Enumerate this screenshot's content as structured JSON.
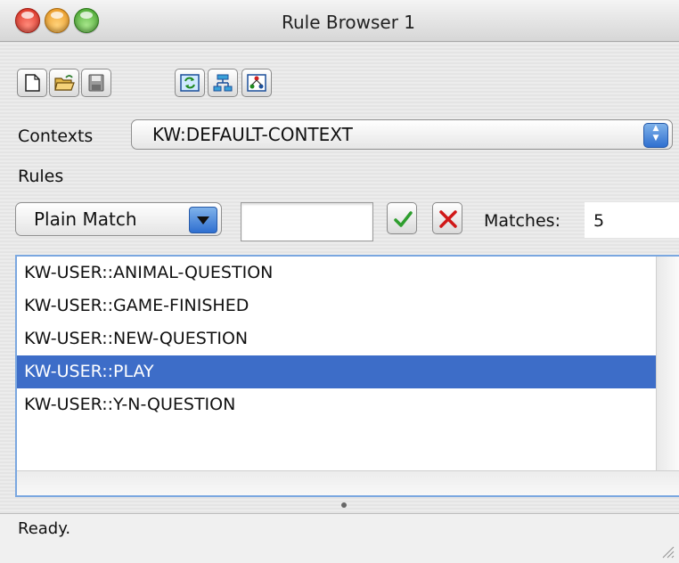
{
  "window": {
    "title": "Rule Browser 1"
  },
  "toolbar": {
    "buttons": [
      {
        "name": "new-document",
        "icon": "new-document-icon"
      },
      {
        "name": "open-folder",
        "icon": "open-folder-icon"
      },
      {
        "name": "save",
        "icon": "save-icon"
      },
      {
        "name": "refresh",
        "icon": "refresh-icon"
      },
      {
        "name": "tree-view",
        "icon": "tree-view-icon"
      },
      {
        "name": "graph-view",
        "icon": "graph-view-icon"
      }
    ]
  },
  "contexts": {
    "label": "Contexts",
    "selected": "KW:DEFAULT-CONTEXT"
  },
  "rules": {
    "label": "Rules",
    "match_mode": "Plain Match",
    "filter_value": "",
    "matches_label": "Matches:",
    "matches_count": "5",
    "items": [
      {
        "label": "KW-USER::ANIMAL-QUESTION",
        "selected": false
      },
      {
        "label": "KW-USER::GAME-FINISHED",
        "selected": false
      },
      {
        "label": "KW-USER::NEW-QUESTION",
        "selected": false
      },
      {
        "label": "KW-USER::PLAY",
        "selected": true
      },
      {
        "label": "KW-USER::Y-N-QUESTION",
        "selected": false
      }
    ]
  },
  "status": {
    "text": "Ready."
  },
  "colors": {
    "selection": "#3d6dc8",
    "accent_blue": "#2f6fd0",
    "check_green": "#2e9e2e",
    "cancel_red": "#d01818"
  }
}
